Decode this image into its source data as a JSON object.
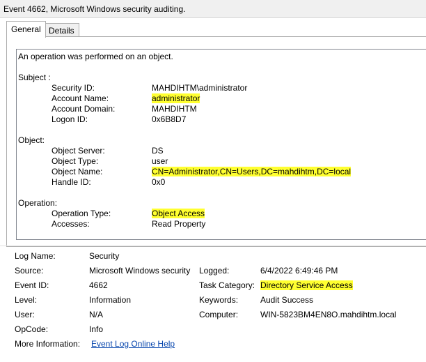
{
  "window": {
    "title": "Event 4662, Microsoft Windows security auditing."
  },
  "tabs": [
    {
      "label": "General",
      "active": true
    },
    {
      "label": "Details",
      "active": false
    }
  ],
  "description": {
    "intro": "An operation was performed on an object.",
    "subject_header": "Subject :",
    "subject": {
      "security_id_label": "Security ID:",
      "security_id": "MAHDIHTM\\administrator",
      "account_name_label": "Account Name:",
      "account_name": "administrator",
      "account_domain_label": "Account Domain:",
      "account_domain": "MAHDIHTM",
      "logon_id_label": "Logon ID:",
      "logon_id": "0x6B8D7"
    },
    "object_header": "Object:",
    "object": {
      "server_label": "Object Server:",
      "server": "DS",
      "type_label": "Object Type:",
      "type": "user",
      "name_label": "Object Name:",
      "name": "CN=Administrator,CN=Users,DC=mahdihtm,DC=local",
      "handle_label": "Handle ID:",
      "handle": "0x0"
    },
    "operation_header": "Operation:",
    "operation": {
      "type_label": "Operation Type:",
      "type": "Object Access",
      "accesses_label": "Accesses:",
      "accesses": "Read Property"
    }
  },
  "properties": {
    "log_name_label": "Log Name:",
    "log_name": "Security",
    "source_label": "Source:",
    "source": "Microsoft Windows security",
    "logged_label": "Logged:",
    "logged": "6/4/2022 6:49:46 PM",
    "event_id_label": "Event ID:",
    "event_id": "4662",
    "task_category_label": "Task Category:",
    "task_category": "Directory Service Access",
    "level_label": "Level:",
    "level": "Information",
    "keywords_label": "Keywords:",
    "keywords": "Audit Success",
    "user_label": "User:",
    "user": "N/A",
    "computer_label": "Computer:",
    "computer": "WIN-5823BM4EN8O.mahdihtm.local",
    "opcode_label": "OpCode:",
    "opcode": "Info",
    "more_info_label": "More Information:",
    "more_info_link": "Event Log Online Help"
  },
  "colors": {
    "highlight": "#ffff30",
    "link": "#0645ad"
  }
}
